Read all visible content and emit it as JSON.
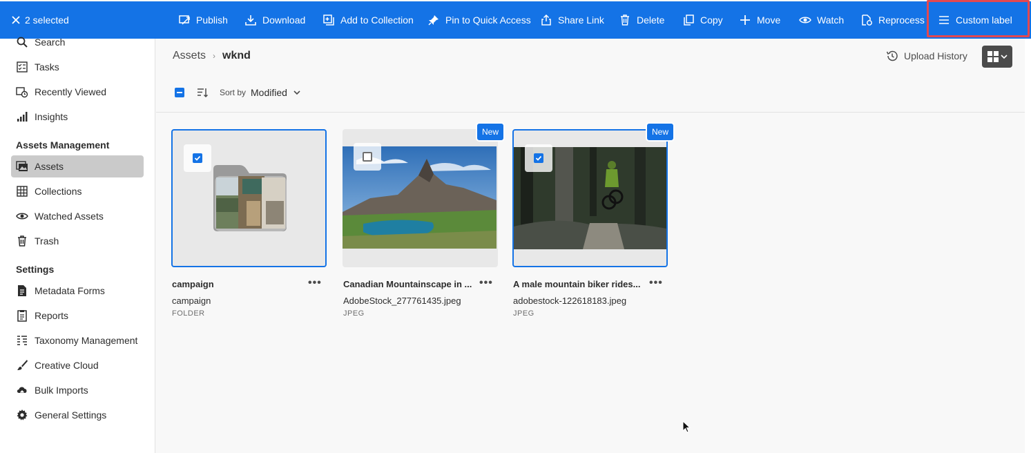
{
  "actionbar": {
    "selected_text": "2 selected",
    "actions": [
      {
        "label": "Publish",
        "icon": "publish-icon"
      },
      {
        "label": "Download",
        "icon": "download-icon"
      },
      {
        "label": "Add to Collection",
        "icon": "add-to-collection-icon"
      },
      {
        "label": "Pin to Quick Access",
        "icon": "pin-icon"
      },
      {
        "label": "Share Link",
        "icon": "share-icon"
      },
      {
        "label": "Delete",
        "icon": "delete-icon"
      },
      {
        "label": "Copy",
        "icon": "copy-icon"
      },
      {
        "label": "Move",
        "icon": "move-icon"
      },
      {
        "label": "Watch",
        "icon": "eye-icon"
      },
      {
        "label": "Reprocess",
        "icon": "reprocess-icon"
      },
      {
        "label": "Custom label",
        "icon": "list-icon"
      }
    ],
    "background": "#1473e6",
    "highlight_color": "#e34850"
  },
  "sidebar": {
    "items_top": [
      {
        "label": "Search",
        "icon": "search-icon"
      },
      {
        "label": "Tasks",
        "icon": "tasks-icon"
      },
      {
        "label": "Recently Viewed",
        "icon": "recent-icon"
      },
      {
        "label": "Insights",
        "icon": "insights-icon"
      }
    ],
    "section_assets": "Assets Management",
    "items_assets": [
      {
        "label": "Assets",
        "icon": "assets-icon",
        "active": true
      },
      {
        "label": "Collections",
        "icon": "collections-icon"
      },
      {
        "label": "Watched Assets",
        "icon": "eye-icon"
      },
      {
        "label": "Trash",
        "icon": "trash-icon"
      }
    ],
    "section_settings": "Settings",
    "items_settings": [
      {
        "label": "Metadata Forms",
        "icon": "metadata-forms-icon"
      },
      {
        "label": "Reports",
        "icon": "reports-icon"
      },
      {
        "label": "Taxonomy Management",
        "icon": "taxonomy-icon"
      },
      {
        "label": "Creative Cloud",
        "icon": "brush-icon"
      },
      {
        "label": "Bulk Imports",
        "icon": "cloud-upload-icon"
      },
      {
        "label": "General Settings",
        "icon": "gear-icon"
      }
    ]
  },
  "main": {
    "breadcrumb": [
      "Assets",
      "wknd"
    ],
    "upload_history": "Upload History",
    "sort_by_label": "Sort by",
    "sort_value": "Modified",
    "cards": [
      {
        "title": "campaign",
        "name": "campaign",
        "type": "FOLDER",
        "selected": true,
        "new_badge": ""
      },
      {
        "title": "Canadian Mountainscape in ...",
        "name": "AdobeStock_277761435.jpeg",
        "type": "JPEG",
        "selected": false,
        "new_badge": "New"
      },
      {
        "title": "A male mountain biker rides...",
        "name": "adobestock-122618183.jpeg",
        "type": "JPEG",
        "selected": true,
        "new_badge": "New"
      }
    ]
  }
}
